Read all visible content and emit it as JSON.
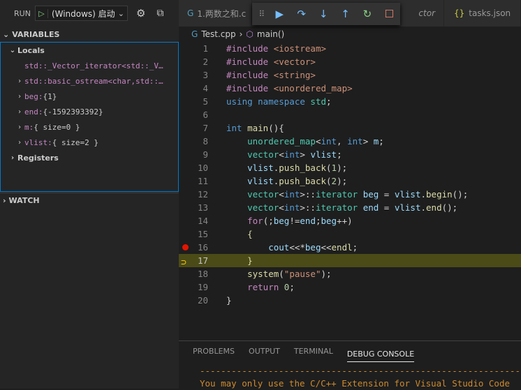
{
  "run": {
    "label": "RUN",
    "config": "(Windows) 启动",
    "icons": [
      "gear-icon",
      "debug-console-icon"
    ]
  },
  "variables": {
    "title": "VARIABLES",
    "locals_label": "Locals",
    "items": [
      {
        "name": "std::_Vector_iterator<std::_V…",
        "value": "",
        "expandable": false
      },
      {
        "name": "std::basic_ostream<char,std::…",
        "value": "",
        "expandable": true
      },
      {
        "name": "beg:",
        "value": "{1}",
        "expandable": true
      },
      {
        "name": "end:",
        "value": "{-1592393392}",
        "expandable": true
      },
      {
        "name": "m:",
        "value": "{ size=0 }",
        "expandable": true
      },
      {
        "name": "vlist:",
        "value": "{ size=2 }",
        "expandable": true
      }
    ],
    "registers_label": "Registers"
  },
  "watch": {
    "title": "WATCH"
  },
  "tabs": [
    {
      "label": "1.两数之和.c",
      "icon": "cpp-icon"
    },
    {
      "label": "ctor",
      "icon": ""
    },
    {
      "label": "tasks.json",
      "icon": "json-icon"
    }
  ],
  "breadcrumb": {
    "file": "Test.cpp",
    "symbol": "main()"
  },
  "debug_toolbar": [
    "continue-icon",
    "step-over-icon",
    "step-into-icon",
    "step-out-icon",
    "restart-icon",
    "stop-icon"
  ],
  "code": {
    "current_line": 17,
    "breakpoint_line": 16,
    "lines": [
      [
        [
          "#include ",
          "pp"
        ],
        [
          "<iostream>",
          "st"
        ]
      ],
      [
        [
          "#include ",
          "pp"
        ],
        [
          "<vector>",
          "st"
        ]
      ],
      [
        [
          "#include ",
          "pp"
        ],
        [
          "<string>",
          "st"
        ]
      ],
      [
        [
          "#include ",
          "pp"
        ],
        [
          "<unordered_map>",
          "st"
        ]
      ],
      [
        [
          "using ",
          "kw"
        ],
        [
          "namespace ",
          "kw"
        ],
        [
          "std",
          "ty"
        ],
        [
          ";",
          "pl"
        ]
      ],
      [],
      [
        [
          "int ",
          "kw"
        ],
        [
          "main",
          "fn"
        ],
        [
          "(){",
          "pl"
        ]
      ],
      [
        [
          "    unordered_map",
          "ty"
        ],
        [
          "<",
          "pl"
        ],
        [
          "int",
          "kw"
        ],
        [
          ", ",
          "pl"
        ],
        [
          "int",
          "kw"
        ],
        [
          "> ",
          "pl"
        ],
        [
          "m",
          "va"
        ],
        [
          ";",
          "pl"
        ]
      ],
      [
        [
          "    vector",
          "ty"
        ],
        [
          "<",
          "pl"
        ],
        [
          "int",
          "kw"
        ],
        [
          "> ",
          "pl"
        ],
        [
          "vlist",
          "va"
        ],
        [
          ";",
          "pl"
        ]
      ],
      [
        [
          "    vlist",
          "va"
        ],
        [
          ".",
          "pl"
        ],
        [
          "push_back",
          "fn"
        ],
        [
          "(",
          "pl"
        ],
        [
          "1",
          "nu"
        ],
        [
          ");",
          "pl"
        ]
      ],
      [
        [
          "    vlist",
          "va"
        ],
        [
          ".",
          "pl"
        ],
        [
          "push_back",
          "fn"
        ],
        [
          "(",
          "pl"
        ],
        [
          "2",
          "nu"
        ],
        [
          ");",
          "pl"
        ]
      ],
      [
        [
          "    vector",
          "ty"
        ],
        [
          "<",
          "pl"
        ],
        [
          "int",
          "kw"
        ],
        [
          ">::",
          "pl"
        ],
        [
          "iterator ",
          "ty"
        ],
        [
          "beg",
          "va"
        ],
        [
          " = ",
          "pl"
        ],
        [
          "vlist",
          "va"
        ],
        [
          ".",
          "pl"
        ],
        [
          "begin",
          "fn"
        ],
        [
          "();",
          "pl"
        ]
      ],
      [
        [
          "    vector",
          "ty"
        ],
        [
          "<",
          "pl"
        ],
        [
          "int",
          "kw"
        ],
        [
          ">::",
          "pl"
        ],
        [
          "iterator ",
          "ty"
        ],
        [
          "end",
          "va"
        ],
        [
          " = ",
          "pl"
        ],
        [
          "vlist",
          "va"
        ],
        [
          ".",
          "pl"
        ],
        [
          "end",
          "fn"
        ],
        [
          "();",
          "pl"
        ]
      ],
      [
        [
          "    for",
          "pp"
        ],
        [
          "(;",
          "pl"
        ],
        [
          "beg",
          "va"
        ],
        [
          "!=",
          "pl"
        ],
        [
          "end",
          "va"
        ],
        [
          ";",
          "pl"
        ],
        [
          "beg",
          "va"
        ],
        [
          "++)",
          "pl"
        ]
      ],
      [
        [
          "    {",
          "fn"
        ]
      ],
      [
        [
          "        cout",
          "va"
        ],
        [
          "<<*",
          "pl"
        ],
        [
          "beg",
          "va"
        ],
        [
          "<<",
          "pl"
        ],
        [
          "endl",
          "fn"
        ],
        [
          ";",
          "pl"
        ]
      ],
      [
        [
          "    }",
          "fn"
        ]
      ],
      [
        [
          "    system",
          "fn"
        ],
        [
          "(",
          "pl"
        ],
        [
          "\"pause\"",
          "st"
        ],
        [
          ");",
          "pl"
        ]
      ],
      [
        [
          "    return ",
          "pp"
        ],
        [
          "0",
          "nu"
        ],
        [
          ";",
          "pl"
        ]
      ],
      [
        [
          "}",
          "pl"
        ]
      ]
    ]
  },
  "panel": {
    "tabs": [
      "PROBLEMS",
      "OUTPUT",
      "TERMINAL",
      "DEBUG CONSOLE"
    ],
    "active": 3,
    "console": [
      "-----------------------------------------------------------------------------",
      "You may only use the C/C++ Extension for Visual Studio Code"
    ]
  }
}
